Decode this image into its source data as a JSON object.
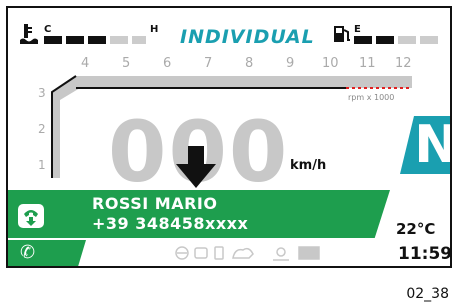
{
  "top_bar": {
    "temp_low": "C",
    "temp_high": "H",
    "mode": "INDIVIDUAL",
    "fuel_empty": "E"
  },
  "rpm": {
    "scale": [
      "4",
      "5",
      "6",
      "7",
      "8",
      "9",
      "10",
      "11",
      "12"
    ],
    "side_marks": [
      "3",
      "2",
      "1"
    ],
    "unit": "rpm x 1000"
  },
  "speed": {
    "value": "000",
    "unit": "km/h"
  },
  "gear": "N",
  "call": {
    "name": "ROSSI MARIO",
    "number": "+39 348458xxxx"
  },
  "status": {
    "temperature": "22°C",
    "time": "11:59"
  },
  "caption": "02_38"
}
